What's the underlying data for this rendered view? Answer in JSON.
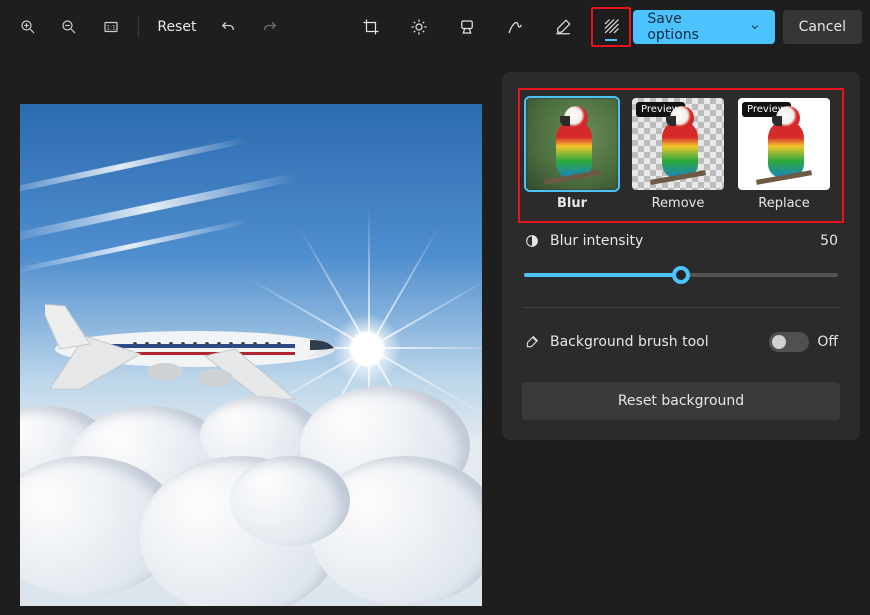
{
  "toolbar": {
    "reset_label": "Reset",
    "save_label": "Save options",
    "cancel_label": "Cancel",
    "icons": {
      "zoom_in": "zoom-in-icon",
      "zoom_out": "zoom-out-icon",
      "fit": "fit-to-window-icon",
      "undo": "undo-icon",
      "redo": "redo-icon",
      "crop": "crop-icon",
      "adjust": "adjustments-icon",
      "filter": "filter-icon",
      "markup": "markup-icon",
      "erase": "erase-icon",
      "background": "background-icon"
    }
  },
  "background_panel": {
    "options": [
      {
        "key": "blur",
        "label": "Blur",
        "selected": true,
        "preview_tag": null
      },
      {
        "key": "remove",
        "label": "Remove",
        "selected": false,
        "preview_tag": "Preview"
      },
      {
        "key": "replace",
        "label": "Replace",
        "selected": false,
        "preview_tag": "Preview"
      }
    ],
    "blur_intensity_label": "Blur intensity",
    "blur_intensity_value": "50",
    "blur_intensity_percent": 50,
    "brush_tool_label": "Background brush tool",
    "brush_tool_state": "Off",
    "reset_label": "Reset background"
  }
}
